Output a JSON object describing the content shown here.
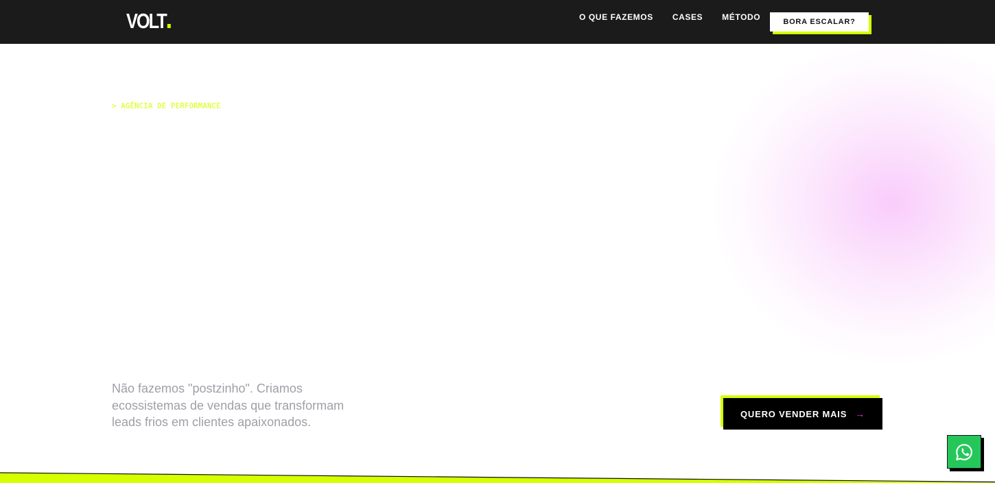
{
  "header": {
    "logo_text": "VOLT",
    "nav": [
      {
        "label": "O QUE FAZEMOS"
      },
      {
        "label": "CASES"
      },
      {
        "label": "MÉTODO"
      }
    ],
    "cta_label": "BORA ESCALAR?"
  },
  "hero": {
    "eyebrow": "> AGÊNCIA DE PERFORMANCE",
    "tagline": "Não fazemos \"postzinho\". Criamos ecossistemas de vendas que transformam leads frios em clientes apaixonados.",
    "cta_label": "QUERO VENDER MAIS",
    "cta_icon": "arrow-right-icon"
  },
  "floating": {
    "whatsapp_icon": "whatsapp-icon"
  },
  "colors": {
    "accent": "#d6ff00",
    "header_bg": "#1b1b1b",
    "magenta": "#ff2fd6",
    "whatsapp": "#25c75b",
    "glow": "#f8c4fa"
  }
}
